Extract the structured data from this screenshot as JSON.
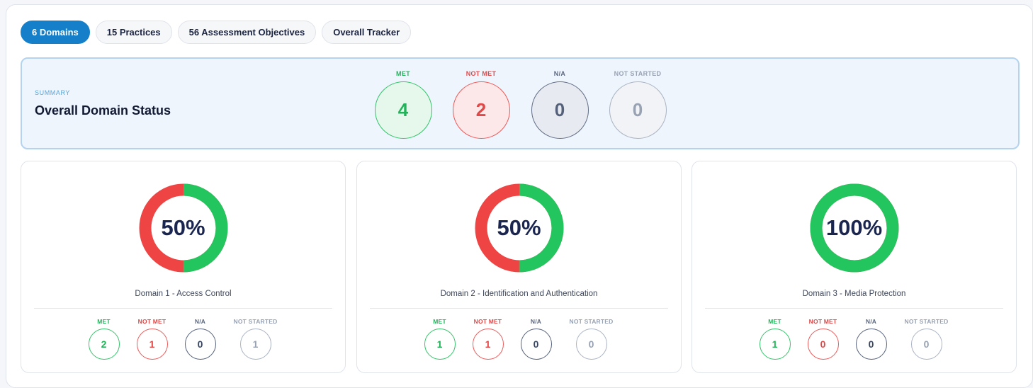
{
  "tabs": [
    {
      "label": "6 Domains",
      "active": true
    },
    {
      "label": "15 Practices",
      "active": false
    },
    {
      "label": "56 Assessment Objectives",
      "active": false
    },
    {
      "label": "Overall Tracker",
      "active": false
    }
  ],
  "summary": {
    "kicker": "SUMMARY",
    "title": "Overall Domain Status",
    "stats": {
      "met": {
        "label": "MET",
        "value": "4"
      },
      "not_met": {
        "label": "NOT MET",
        "value": "2"
      },
      "na": {
        "label": "N/A",
        "value": "0"
      },
      "not_started": {
        "label": "NOT STARTED",
        "value": "0"
      }
    }
  },
  "colors": {
    "met": "#22c55e",
    "not_met": "#ef4444",
    "accent": "#1580c9"
  },
  "domains": [
    {
      "title": "Domain 1 - Access Control",
      "percent_label": "50%",
      "met_fraction": 0.5,
      "stats": {
        "met": {
          "label": "MET",
          "value": "2"
        },
        "not_met": {
          "label": "NOT MET",
          "value": "1"
        },
        "na": {
          "label": "N/A",
          "value": "0"
        },
        "not_started": {
          "label": "NOT STARTED",
          "value": "1"
        }
      }
    },
    {
      "title": "Domain 2 - Identification and Authentication",
      "percent_label": "50%",
      "met_fraction": 0.5,
      "stats": {
        "met": {
          "label": "MET",
          "value": "1"
        },
        "not_met": {
          "label": "NOT MET",
          "value": "1"
        },
        "na": {
          "label": "N/A",
          "value": "0"
        },
        "not_started": {
          "label": "NOT STARTED",
          "value": "0"
        }
      }
    },
    {
      "title": "Domain 3 - Media Protection",
      "percent_label": "100%",
      "met_fraction": 1.0,
      "stats": {
        "met": {
          "label": "MET",
          "value": "1"
        },
        "not_met": {
          "label": "NOT MET",
          "value": "0"
        },
        "na": {
          "label": "N/A",
          "value": "0"
        },
        "not_started": {
          "label": "NOT STARTED",
          "value": "0"
        }
      }
    }
  ]
}
